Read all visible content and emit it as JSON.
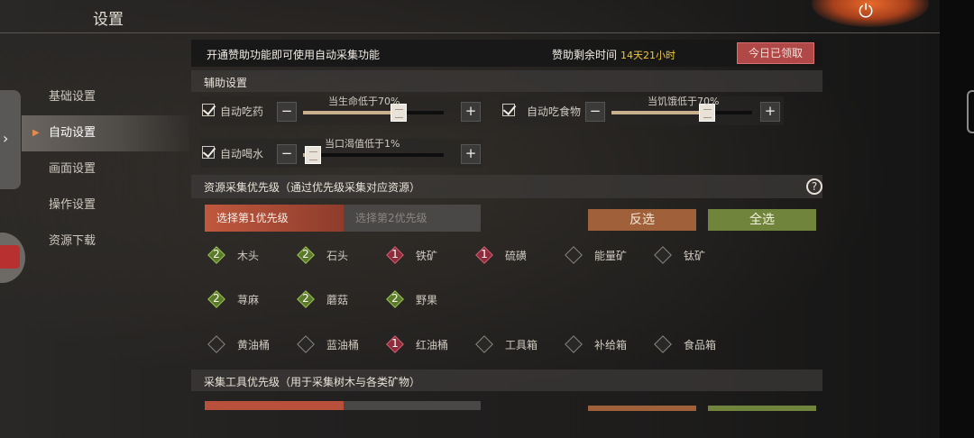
{
  "title": "设置",
  "menu": [
    {
      "label": "基础设置"
    },
    {
      "label": "自动设置"
    },
    {
      "label": "画面设置"
    },
    {
      "label": "操作设置"
    },
    {
      "label": "资源下载"
    }
  ],
  "banner": {
    "message": "开通赞助功能即可使用自动采集功能",
    "remaining_label": "赞助剩余时间",
    "remaining_value": "14天21小时",
    "claim_button": "今日已领取"
  },
  "assist": {
    "title": "辅助设置",
    "eat_medicine": {
      "label": "自动吃药",
      "caption": "当生命低于70%",
      "value": 0.7,
      "checked": true
    },
    "eat_food": {
      "label": "自动吃食物",
      "caption": "当饥饿低于70%",
      "value": 0.7,
      "checked": true
    },
    "drink_water": {
      "label": "自动喝水",
      "caption": "当口渴值低于1%",
      "value": 0.01,
      "checked": true
    }
  },
  "gather": {
    "title": "资源采集优先级（通过优先级采集对应资源）",
    "tab1": "选择第1优先级",
    "tab2": "选择第2优先级",
    "invert_button": "反选",
    "select_all_button": "全选",
    "resources": [
      {
        "label": "木头",
        "level": "2"
      },
      {
        "label": "石头",
        "level": "2"
      },
      {
        "label": "铁矿",
        "level": "1"
      },
      {
        "label": "硫磺",
        "level": "1"
      },
      {
        "label": "能量矿",
        "level": ""
      },
      {
        "label": "钛矿",
        "level": ""
      },
      {
        "label": "荨麻",
        "level": "2"
      },
      {
        "label": "蘑菇",
        "level": "2"
      },
      {
        "label": "野果",
        "level": "2"
      },
      {
        "label": "黄油桶",
        "level": ""
      },
      {
        "label": "蓝油桶",
        "level": ""
      },
      {
        "label": "红油桶",
        "level": "1"
      },
      {
        "label": "工具箱",
        "level": ""
      },
      {
        "label": "补给箱",
        "level": ""
      },
      {
        "label": "食品箱",
        "level": ""
      }
    ]
  },
  "tools": {
    "title": "采集工具优先级（用于采集树木与各类矿物）"
  },
  "colors": {
    "tab_active": "#c0583e",
    "invert": "#a0603a",
    "select_all": "#71843c",
    "claim": "#b04848",
    "level1": "#8e2c3c",
    "level2": "#5b7a2a",
    "highlight_time": "#f0c83c"
  }
}
